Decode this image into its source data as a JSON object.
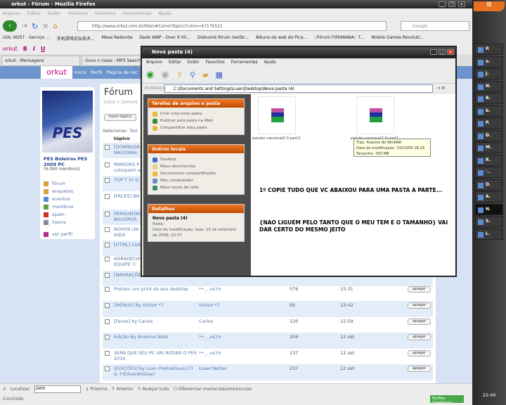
{
  "firefox": {
    "title": "orkut - Fórum - Mozilla Firefox",
    "menu": [
      "Arquivo",
      "Editar",
      "Exibir",
      "Histórico",
      "Favoritos",
      "Ferramentas",
      "Ajuda"
    ],
    "url": "http://www.orkut.com.br/Main#CommTopics?cmm=67176521",
    "search_placeholder": "Google",
    "bookmarks": [
      "UOL HOST - Serviço ...",
      "手机游戏论坛技术...",
      "Mesa Redonda",
      "Dedo WAP - Over 9 00...",
      "Diskusné fórum (wolbr...",
      "Álbuns da web do Pica...",
      "::Fórum FIFAMANIA:: T...",
      "Mobile Games Revoluti..."
    ],
    "orkut_toolbar": {
      "logo": "orkut",
      "bold": "B",
      "italic": "I",
      "underline": "U"
    },
    "tabs": [
      "orkut - Mensagens",
      "Guns n roses - MP3 Search"
    ]
  },
  "orkut": {
    "logo": "orkut",
    "nav": [
      "Início",
      "Perfil",
      "Página de rec"
    ],
    "community": {
      "name": "PES Boleiros PES 2009 PC",
      "members": "(9.090 membros)",
      "image_text": "PES",
      "menu": [
        "fórum",
        "enquetes",
        "eventos",
        "membros",
        "spam",
        "lixeira"
      ],
      "view_profile": "ver perfil"
    },
    "forum": {
      "title": "Fórum",
      "breadcrumb": "Início > Comuni",
      "new_topic": "novo tópico",
      "select_label": "Selecionar:",
      "select_all": "Tod",
      "col_topic": "tópico",
      "delete_label": "apagar",
      "topics_partial": [
        "[DOWNLOA NACIONAL",
        "MIRRORS P coloquem a",
        "TOP'7 5º D",
        "[FACES] BR",
        "PERGUNTAS BOLEIROS",
        "NOVOS UN AQUI",
        "[HTML] Cod",
        "AGRADECIM EQUIPE !!",
        "[NARRAÇÕE"
      ],
      "topics": [
        {
          "title": "Postem um print do seu desktop",
          "author": "*•.¸¸нєтσ",
          "posts": "576",
          "time": "15:31"
        },
        {
          "title": "[MENUS] By Victoя *7",
          "author": "Victoя *7",
          "posts": "92",
          "time": "13:42"
        },
        {
          "title": "[Faces] by Carlos",
          "author": "Carlos",
          "posts": "120",
          "time": "12:59"
        },
        {
          "title": "Edição By Boleiros Neto",
          "author": "*•.¸¸нєтσ",
          "posts": "204",
          "time": "12 set"
        },
        {
          "title": "SERÁ QUE SEU PC VAI RODAR O PES 2010",
          "author": "*•.¸¸нєтσ",
          "posts": "137",
          "time": "12 set"
        },
        {
          "title": "[EDIÇÕES] by Luan Freitas(luan17) & ©Eduardo(Gay)",
          "author": "Łuaи fяєitas",
          "posts": "237",
          "time": "12 set"
        }
      ]
    }
  },
  "explorer": {
    "title": "Nova pasta (4)",
    "menu": [
      "Arquivo",
      "Editar",
      "Exibir",
      "Favoritos",
      "Ferramentas",
      "Ajuda"
    ],
    "address_label": "Endereço",
    "address": "C:\\Documents and Settings\\Luan\\Desktop\\Nova pasta (4)",
    "go": "Ir",
    "tasks": {
      "title": "Tarefas de arquivo e pasta",
      "items": [
        "Criar uma nova pasta",
        "Publicar esta pasta na Web",
        "Compartilhar esta pasta"
      ]
    },
    "places": {
      "title": "Outros locais",
      "items": [
        "Desktop",
        "Meus documentos",
        "Documentos compartilhados",
        "Meu computador",
        "Meus locais de rede"
      ]
    },
    "details": {
      "title": "Detalhes",
      "name": "Nova pasta (4)",
      "type": "Pasta",
      "modified": "Data de modificação: hoje, 13 de setembro de 2009, 22:37"
    },
    "files": [
      "paixão nacional2.0.part2",
      "paixão nacional2.0.part1"
    ],
    "tooltip": [
      "Tipo: Arquivo do WinRAR",
      "Data de modificação: 7/9/2009 18:29",
      "Tamanho: 700 MB"
    ],
    "note1": "1º COPIE TUDO QUE VC ABAIXOU PARA UMA PASTA A PARTE...",
    "note2": "{NAO LIGUEM PELO TANTO QUE O MEU TEM E O TAMANHO} VAI DAR CERTO DO MESMO JEITO"
  },
  "findbar": {
    "label": "Localizar:",
    "value": "2009",
    "next": "Próxima",
    "prev": "Anterior",
    "highlight": "Realçar tudo",
    "match_case": "Diferenciar maiúsculas/minúsculas"
  },
  "status": {
    "text": "Concluído",
    "mcafee": "McAfee SiteAdvisor"
  },
  "taskbar": {
    "items": [
      "P.",
      "o.",
      "J.",
      "N.",
      "B.",
      "b.",
      "P.",
      "D.",
      "M.",
      "R.",
      "'..",
      "D.",
      "A.",
      "N.",
      "S.",
      "L."
    ],
    "clock": "22:40"
  }
}
